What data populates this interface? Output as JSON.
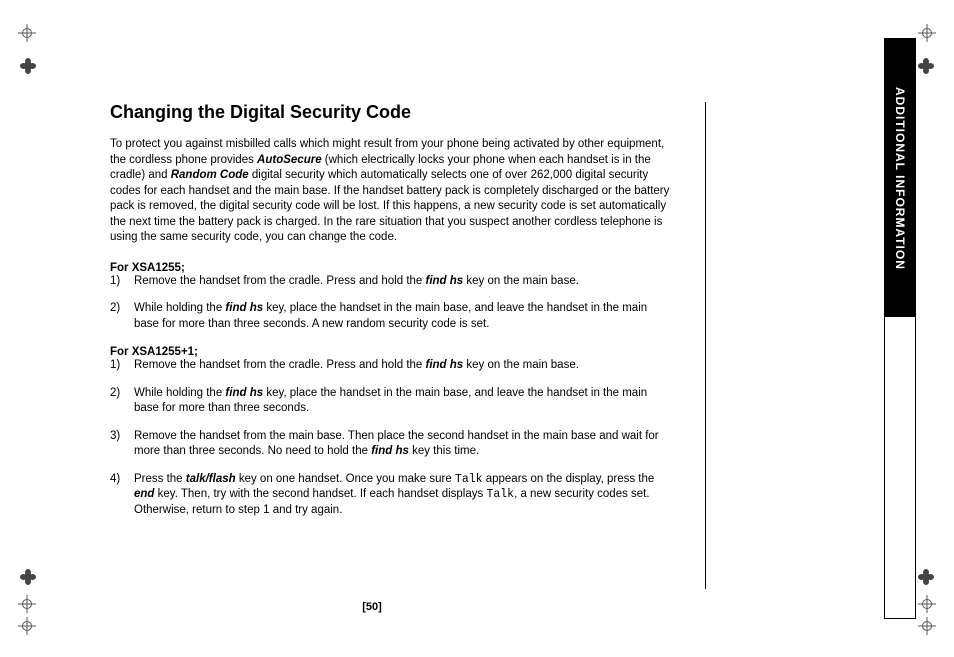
{
  "sidebar": {
    "label": "ADDITIONAL INFORMATION"
  },
  "page_number": "[50]",
  "heading": "Changing the Digital Security Code",
  "intro": {
    "pre": "To protect you against misbilled calls which might result from your phone being activated by other equipment, the cordless phone provides ",
    "autosecure": "AutoSecure",
    "mid1": " (which electrically locks your phone when each handset is in the cradle) and ",
    "random_code": "Random Code",
    "post": " digital security which automatically selects one of over 262,000 digital security codes for each handset and the main base. If the handset battery pack is completely discharged or the battery pack is removed, the digital security code will be lost. If this happens, a new security code is set automatically the next time the battery pack is charged. In the rare situation that you suspect another cordless telephone is using the same security code, you can change the code."
  },
  "sectionA": {
    "label": "For XSA1255;",
    "steps": [
      {
        "num": "1)",
        "pre": "Remove the handset from the cradle. Press and hold the ",
        "key": "find hs",
        "post": " key on the main base."
      },
      {
        "num": "2)",
        "pre": "While holding the ",
        "key": "find hs",
        "post": " key, place the handset in the main base, and leave the handset in the main base for more than three seconds. A new random security code is set."
      }
    ]
  },
  "sectionB": {
    "label": "For XSA1255+1;",
    "steps": [
      {
        "num": "1)",
        "pre": "Remove the handset from the cradle. Press and hold the ",
        "key": "find hs",
        "post": " key on the main base."
      },
      {
        "num": "2)",
        "pre": "While holding the ",
        "key": "find hs",
        "post": " key, place the handset in the main base, and leave the handset in the main base for more than three seconds."
      },
      {
        "num": "3)",
        "pre": "Remove the handset from the main base. Then place the second handset in the main base and wait for more than three seconds. No need to hold the ",
        "key": "find hs",
        "post": " key this time."
      },
      {
        "num": "4)",
        "pre": "Press the ",
        "key1": "talk/flash",
        "mid1": " key on one handset. Once you make sure ",
        "mono1": "Talk",
        "mid2": " appears on the display, press the ",
        "key2": "end",
        "mid3": " key. Then, try with the second handset. If each handset displays ",
        "mono2": "Talk",
        "post": ", a new security codes set. Otherwise, return to step 1 and try again."
      }
    ]
  }
}
